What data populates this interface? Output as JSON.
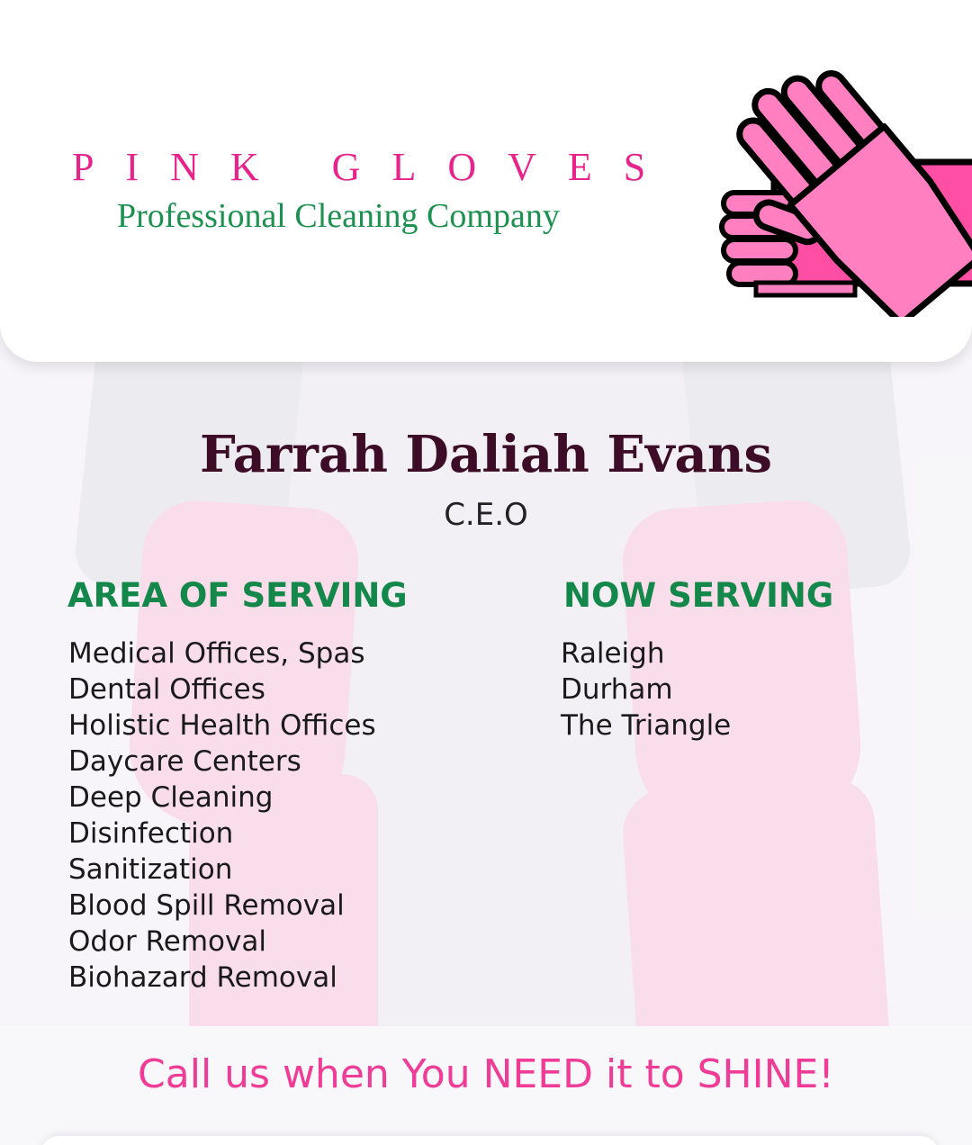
{
  "header": {
    "brand_name": "PINK GLOVES",
    "brand_tagline": "Professional Cleaning Company",
    "logo_icon": "pink-gloves-icon",
    "colors": {
      "brand_pink": "#e8248c",
      "brand_green": "#1d9150",
      "glove_pink": "#ff7fc0",
      "glove_dark": "#ff4fa4"
    }
  },
  "profile": {
    "name": "Farrah Daliah Evans",
    "role": "C.E.O"
  },
  "areas": {
    "title": "AREA OF SERVING",
    "items": [
      "Medical Offices, Spas",
      "Dental Offices",
      "Holistic Health Offices",
      "Daycare Centers",
      "Deep Cleaning",
      "Disinfection",
      "Sanitization",
      "Blood Spill Removal",
      "Odor Removal",
      "Biohazard Removal"
    ]
  },
  "locations": {
    "title": "NOW SERVING",
    "items": [
      "Raleigh",
      "Durham",
      "The Triangle"
    ]
  },
  "tagline": "Call us when You NEED it to SHINE!",
  "accent_colors": {
    "heading_green": "#13884a",
    "tagline_pink": "#ee3c97",
    "name_color": "#3d0d27"
  }
}
